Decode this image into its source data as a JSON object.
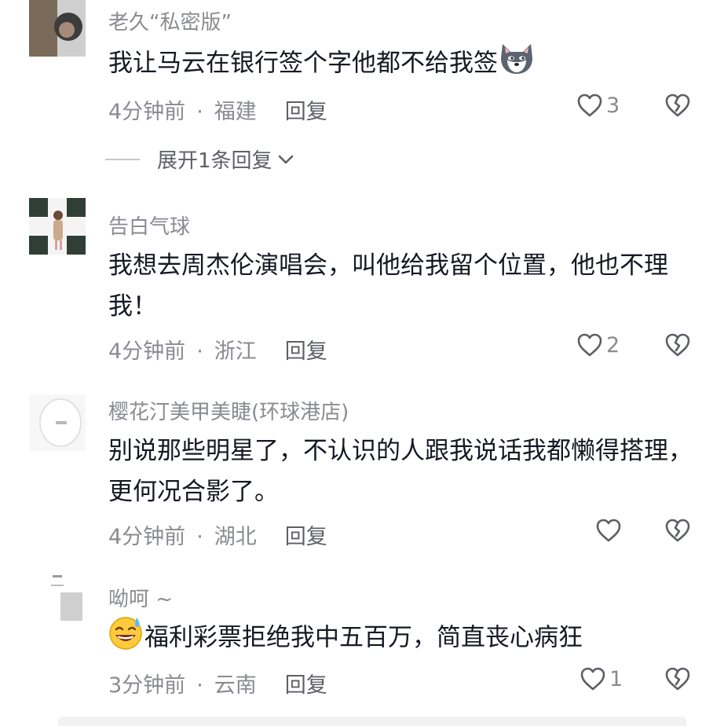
{
  "comments": [
    {
      "username": "老久“私密版”",
      "text": "我让马云在银行签个字他都不给我签",
      "emoji": "wolf-emoji",
      "time": "4分钟前",
      "location": "福建",
      "reply_label": "回复",
      "likes": "3",
      "expand_label": "展开1条回复"
    },
    {
      "username": "告白气球",
      "text": "我想去周杰伦演唱会，叫他给我留个位置，他也不理我！",
      "time": "4分钟前",
      "location": "浙江",
      "reply_label": "回复",
      "likes": "2"
    },
    {
      "username": "樱花汀美甲美睫(环球港店)",
      "text": "别说那些明星了，不认识的人跟我说话我都懒得搭理，更何况合影了。",
      "time": "4分钟前",
      "location": "湖北",
      "reply_label": "回复",
      "likes": ""
    },
    {
      "username": "呦呵 ~",
      "text": "福利彩票拒绝我中五百万，简直丧心病狂",
      "emoji": "sweat-smile-emoji",
      "time": "3分钟前",
      "location": "云南",
      "reply_label": "回复",
      "likes": "1"
    }
  ],
  "meta_separator": "·",
  "colors": {
    "text": "#161823",
    "secondary": "#8a8b91",
    "icon": "#5e5f66"
  }
}
